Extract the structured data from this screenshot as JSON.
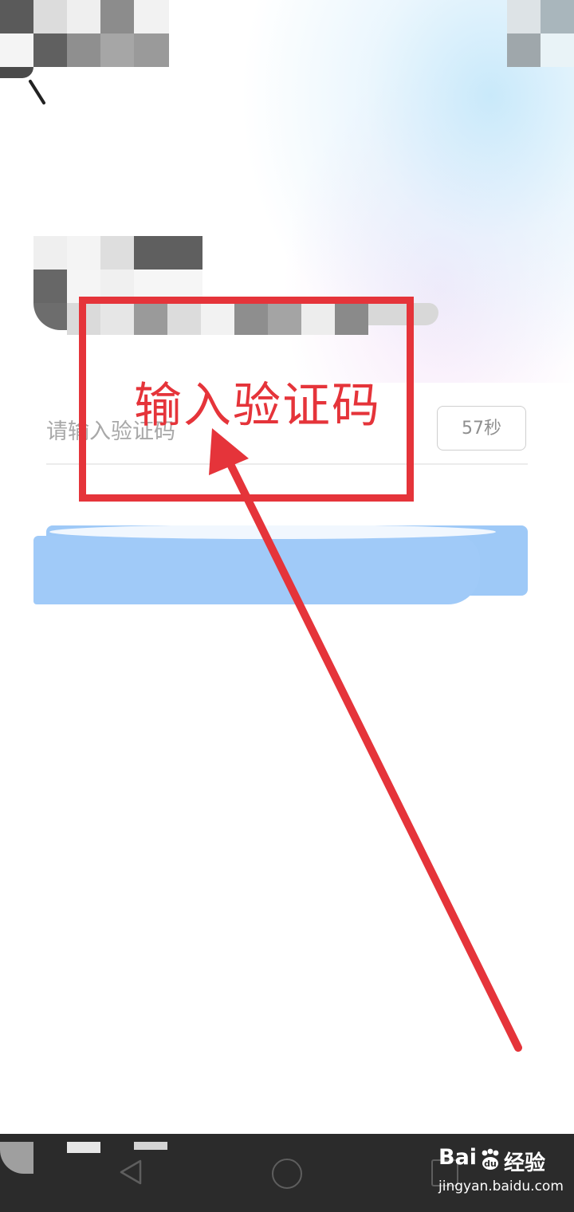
{
  "verification": {
    "placeholder": "请输入验证码",
    "countdown": "57秒"
  },
  "annotation": {
    "label": "输入验证码",
    "color": "#e5343a"
  },
  "submit": {
    "color": "#9ec9f7"
  },
  "icons": {
    "back": "back-arrow-icon",
    "nav_back": "triangle-back-icon",
    "nav_home": "circle-home-icon",
    "nav_recent": "square-recent-icon"
  },
  "watermark": {
    "logo_text": "Bai",
    "logo_suffix": "du",
    "brand": "经验",
    "url": "jingyan.baidu.com"
  }
}
